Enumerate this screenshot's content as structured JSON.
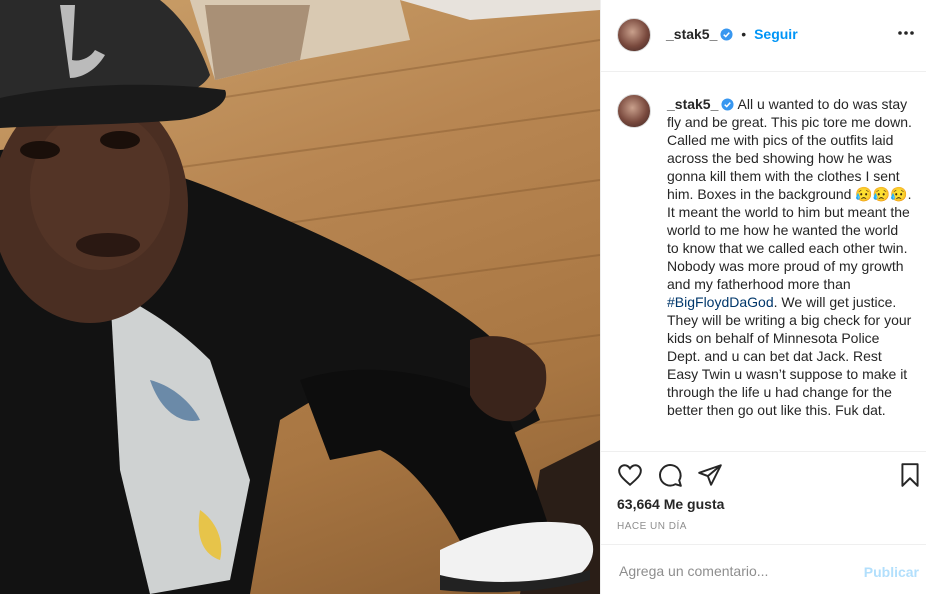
{
  "post": {
    "username": "_stak5_",
    "follow_label": "Seguir",
    "separator": "•",
    "caption_text": "All u wanted to do was stay fly and be great. This pic tore me down. Called me with pics of the outfits laid across the bed showing how he was gonna kill them with the clothes I sent him. Boxes in the background 😥😥😥. It meant the world to him but meant the world to me how he wanted the world to know that we called each other twin. Nobody was more proud of my growth and my fatherhood more than ",
    "hashtag": "#BigFloydDaGod",
    "caption_text_after": ". We will get justice. They will be writing a big check for your kids on behalf of Minnesota Police Dept. and u can bet dat Jack. Rest Easy Twin u wasn’t suppose to make it through the life u had change for the better then go out like this. Fuk dat.",
    "likes": "63,664 Me gusta",
    "time_ago": "HACE UN DÍA",
    "comment_placeholder": "Agrega un comentario...",
    "publish_label": "Publicar"
  },
  "icons": {
    "verified": "verified-badge-icon",
    "more": "more-options-icon",
    "like": "heart-icon",
    "comment": "comment-icon",
    "share": "share-icon",
    "save": "bookmark-icon"
  },
  "colors": {
    "accent": "#0095f6",
    "verified": "#3897f0",
    "hashtag": "#00376b",
    "muted": "#8e8e8e",
    "publish_disabled": "#b2dffc"
  }
}
